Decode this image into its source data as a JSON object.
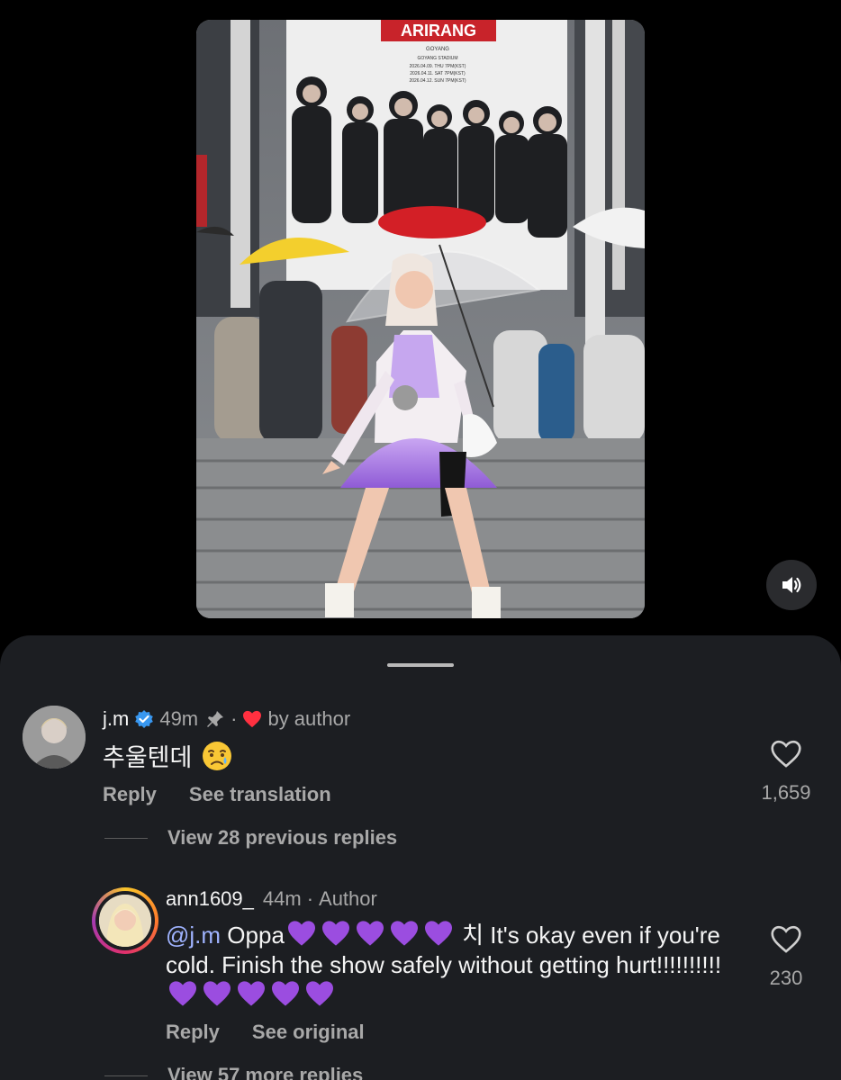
{
  "video": {
    "banner_title": "ARIRANG",
    "banner_venue": "GOYANG",
    "banner_stadium": "GOYANG STADIUM",
    "banner_dates": [
      "2026.04.09. THU 7PM(KST)",
      "2026.04.11. SAT 7PM(KST)",
      "2026.04.12. SUN 7PM(KST)"
    ],
    "sound_icon": "speaker-icon"
  },
  "comments": [
    {
      "username": "j.m",
      "verified": true,
      "time": "49m",
      "pinned": true,
      "liked_by_author_label": "by author",
      "text": "추울텐데",
      "emoji": "crying-face",
      "reply_label": "Reply",
      "translate_label": "See translation",
      "likes": "1,659",
      "view_replies_label": "View 28 previous replies"
    },
    {
      "username": "ann1609_",
      "time": "44m",
      "role": "Author",
      "mention": "@j.m",
      "text_part1": "Oppa",
      "text_part2": "치 It's okay even if you're cold. Finish the show safely without getting hurt!!!!!!!!!!",
      "reply_label": "Reply",
      "original_label": "See original",
      "likes": "230",
      "view_replies_label": "View 57 more replies"
    }
  ],
  "colors": {
    "sheet_bg": "#1c1e22",
    "verified_blue": "#3897f0",
    "heart_red": "#ff3040",
    "purple_heart": "#9b4de0",
    "mention_blue": "#9fb3ff"
  }
}
